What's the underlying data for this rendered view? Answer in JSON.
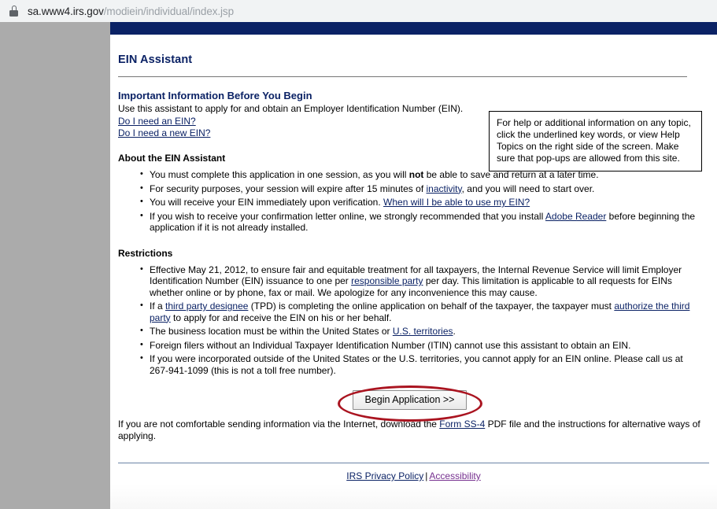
{
  "browser": {
    "lock_icon": "lock-icon",
    "url_host": "sa.www4.irs.gov",
    "url_path": "/modiein/individual/index.jsp"
  },
  "page": {
    "app_title": "EIN Assistant",
    "intro": {
      "heading": "Important Information Before You Begin",
      "text": "Use this assistant to apply for and obtain an Employer Identification Number (EIN).",
      "link_need_ein": "Do I need an EIN?",
      "link_need_new_ein": "Do I need a new EIN?"
    },
    "help_box": {
      "text": "For help or additional information on any topic, click the underlined key words, or view Help Topics on the right side of the screen. Make sure that pop-ups are allowed from this site."
    },
    "about": {
      "heading": "About the EIN Assistant",
      "bullet1_a": "You must complete this application in one session, as you will ",
      "bullet1_bold": "not",
      "bullet1_b": " be able to save and return at a later time.",
      "bullet2_a": "For security purposes, your session will expire after 15 minutes of ",
      "bullet2_link": "inactivity",
      "bullet2_b": ", and you will need to start over.",
      "bullet3_a": "You will receive your EIN immediately upon verification. ",
      "bullet3_link": "When will I be able to use my EIN?",
      "bullet4_a": "If you wish to receive your confirmation letter online, we strongly recommended that you install ",
      "bullet4_link": "Adobe Reader",
      "bullet4_b": " before beginning the application if it is not already installed."
    },
    "restrictions": {
      "heading": "Restrictions",
      "bullet1_a": "Effective May 21, 2012, to ensure fair and equitable treatment for all taxpayers, the Internal Revenue Service will limit Employer Identification Number (EIN) issuance to one per ",
      "bullet1_link": "responsible party",
      "bullet1_b": " per day. This limitation is applicable to all requests for EINs whether online or by phone, fax or mail.  We apologize for any inconvenience this may cause.",
      "bullet2_a": "If a ",
      "bullet2_link1": "third party designee",
      "bullet2_b": " (TPD) is completing the online application on behalf of the taxpayer, the taxpayer must ",
      "bullet2_link2": "authorize the third party",
      "bullet2_c": " to apply for and receive the EIN on his or her behalf.",
      "bullet3_a": "The business location must be within the United States or ",
      "bullet3_link": "U.S. territories",
      "bullet3_b": ".",
      "bullet4": "Foreign filers without an Individual Taxpayer Identification Number (ITIN) cannot use this assistant to obtain an EIN.",
      "bullet5": "If you were incorporated outside of the United States or the U.S. territories, you cannot apply for an EIN online. Please call us at 267-941-1099 (this is not a toll free number)."
    },
    "begin_button": "Begin Application >>",
    "closing": {
      "text_a": "If you are not comfortable sending information via the Internet, download the ",
      "link": "Form SS-4",
      "text_b": " PDF file and the instructions for alternative ways of applying."
    },
    "footer": {
      "privacy_policy": "IRS Privacy Policy",
      "separator": "|",
      "accessibility": "Accessibility"
    }
  },
  "colors": {
    "navy": "#0b2265",
    "gutter_gray": "#ababab",
    "visited_purple": "#76308f",
    "annotation_red": "#aa1420"
  }
}
